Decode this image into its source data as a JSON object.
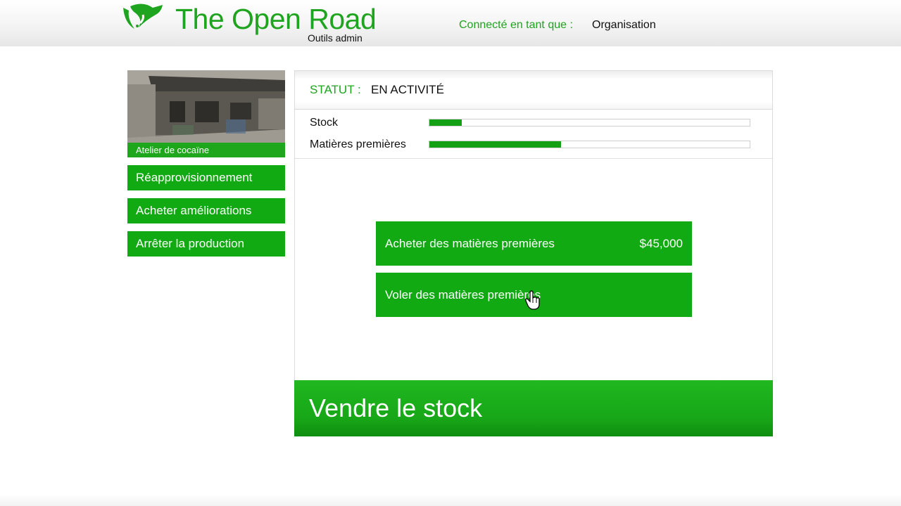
{
  "header": {
    "brand": "The Open Road",
    "subtitle": "Outils admin",
    "login_label": "Connecté en tant que :",
    "login_value": "Organisation"
  },
  "property": {
    "caption": "Atelier de cocaïne"
  },
  "sidebar": {
    "items": [
      {
        "label": "Réapprovisionnement"
      },
      {
        "label": "Acheter améliorations"
      },
      {
        "label": "Arrêter la production"
      }
    ]
  },
  "status": {
    "label": "STATUT :",
    "value": "EN ACTIVITÉ"
  },
  "bars": [
    {
      "label": "Stock",
      "fraction": 0.1
    },
    {
      "label": "Matières premières",
      "fraction": 0.41
    }
  ],
  "actions": [
    {
      "label": "Acheter des matières premières",
      "price": "$45,000"
    },
    {
      "label": "Voler des matières premières",
      "price": ""
    }
  ],
  "sell": {
    "label": "Vendre le stock"
  },
  "colors": {
    "brand_green": "#1ea41e",
    "button_green": "#12aa12"
  },
  "icons": {
    "logo": "open-road-logo-icon",
    "cursor": "hand-pointer-icon"
  }
}
